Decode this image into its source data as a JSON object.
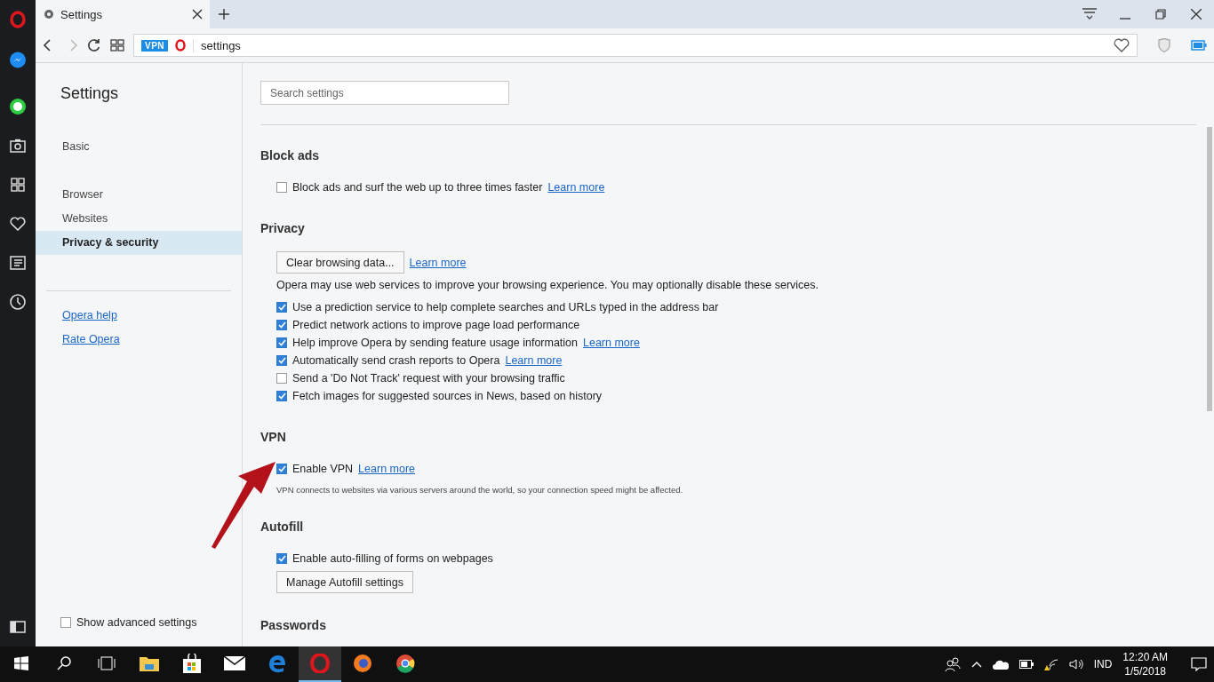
{
  "browser": {
    "tab_title": "Settings",
    "vpn_badge": "VPN",
    "address": "settings"
  },
  "settings_nav": {
    "title": "Settings",
    "groups": [
      [
        {
          "label": "Basic",
          "selected": false
        }
      ],
      [
        {
          "label": "Browser",
          "selected": false
        },
        {
          "label": "Websites",
          "selected": false
        },
        {
          "label": "Privacy & security",
          "selected": true
        }
      ]
    ],
    "links": [
      "Opera help",
      "Rate Opera"
    ],
    "show_advanced": {
      "label": "Show advanced settings",
      "checked": false
    }
  },
  "search": {
    "placeholder": "Search settings"
  },
  "sections": [
    {
      "title": "Block ads",
      "rows": [
        {
          "kind": "checkbox",
          "label": "Block ads and surf the web up to three times faster",
          "checked": false,
          "link": "Learn more"
        }
      ]
    },
    {
      "title": "Privacy",
      "rows": [
        {
          "kind": "button",
          "label": "Clear browsing data...",
          "link": "Learn more"
        },
        {
          "kind": "text",
          "label": "Opera may use web services to improve your browsing experience. You may optionally disable these services."
        },
        {
          "kind": "checkbox",
          "label": "Use a prediction service to help complete searches and URLs typed in the address bar",
          "checked": true
        },
        {
          "kind": "checkbox",
          "label": "Predict network actions to improve page load performance",
          "checked": true
        },
        {
          "kind": "checkbox",
          "label": "Help improve Opera by sending feature usage information",
          "checked": true,
          "link": "Learn more"
        },
        {
          "kind": "checkbox",
          "label": "Automatically send crash reports to Opera",
          "checked": true,
          "link": "Learn more"
        },
        {
          "kind": "checkbox",
          "label": "Send a 'Do Not Track' request with your browsing traffic",
          "checked": false
        },
        {
          "kind": "checkbox",
          "label": "Fetch images for suggested sources in News, based on history",
          "checked": true
        }
      ]
    },
    {
      "title": "VPN",
      "rows": [
        {
          "kind": "checkbox",
          "label": "Enable VPN",
          "checked": true,
          "link": "Learn more"
        },
        {
          "kind": "note",
          "label": "VPN connects to websites via various servers around the world, so your connection speed might be affected."
        }
      ]
    },
    {
      "title": "Autofill",
      "rows": [
        {
          "kind": "checkbox",
          "label": "Enable auto-filling of forms on webpages",
          "checked": true
        },
        {
          "kind": "button",
          "label": "Manage Autofill settings"
        }
      ]
    },
    {
      "title": "Passwords"
    }
  ],
  "taskbar": {
    "apps": [
      {
        "selected": false
      },
      {
        "selected": false
      },
      {
        "selected": false
      },
      {
        "selected": false
      },
      {
        "selected": true
      },
      {
        "selected": false
      },
      {
        "selected": false
      }
    ],
    "language": "IND",
    "time": "12:20 AM",
    "date": "1/5/2018"
  }
}
